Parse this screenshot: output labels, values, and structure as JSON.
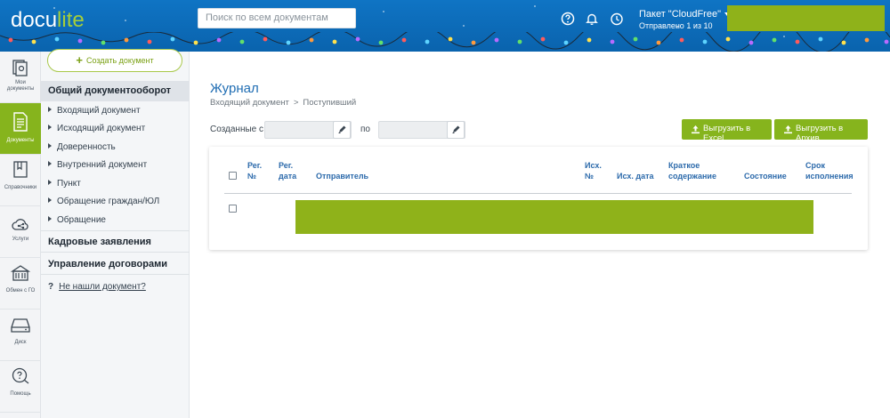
{
  "header": {
    "logo_main": "docu",
    "logo_accent": "lite",
    "search_placeholder": "Поиск по всем документам",
    "package_label": "Пакет \"CloudFree\"",
    "package_sub": "Отправлено 1 из 10",
    "icons": [
      "help-icon",
      "bell-icon",
      "clock-icon"
    ],
    "accent_color": "#86b41d",
    "bar_color": "#0f74c4"
  },
  "rail": {
    "items": [
      {
        "label_line1": "Мои",
        "label_line2": "документы",
        "icon": "my-documents-icon"
      },
      {
        "label_line1": "Документы",
        "label_line2": "",
        "icon": "document-icon",
        "active": true
      },
      {
        "label_line1": "Справочники",
        "label_line2": "",
        "icon": "book-icon"
      },
      {
        "label_line1": "Услуги",
        "label_line2": "",
        "icon": "cloud-share-icon"
      },
      {
        "label_line1": "Обмен с ГО",
        "label_line2": "",
        "icon": "building-icon"
      },
      {
        "label_line1": "Диск",
        "label_line2": "",
        "icon": "disk-icon"
      },
      {
        "label_line1": "Помощь",
        "label_line2": "",
        "icon": "help-chat-icon"
      }
    ]
  },
  "nav": {
    "create_button": "Создать документ",
    "section_general": "Общий документооборот",
    "items": [
      "Входящий документ",
      "Исходящий документ",
      "Доверенность",
      "Внутренний документ",
      "Пункт",
      "Обращение граждан/ЮЛ",
      "Обращение"
    ],
    "section_hr": "Кадровые заявления",
    "section_contracts": "Управление договорами",
    "help_mark": "?",
    "help_link": "Не нашли документ?"
  },
  "main": {
    "title": "Журнал",
    "breadcrumb_parent": "Входящий документ",
    "breadcrumb_sep": ">",
    "breadcrumb_current": "Поступивший",
    "filter_from_label": "Созданные с",
    "filter_to_label": "по",
    "export_excel": "Выгрузить в Excel",
    "export_archive": "Выгрузить в Архив"
  },
  "table": {
    "columns": [
      {
        "line1": "Рег.",
        "line2": "№"
      },
      {
        "line1": "Рег.",
        "line2": "дата"
      },
      {
        "line1": "Отправитель",
        "line2": ""
      },
      {
        "line1": "Исх.",
        "line2": "№"
      },
      {
        "line1": "Исх. дата",
        "line2": ""
      },
      {
        "line1": "Краткое",
        "line2": "содержание"
      },
      {
        "line1": "Состояние",
        "line2": ""
      },
      {
        "line1": "Срок",
        "line2": "исполнения"
      }
    ]
  }
}
